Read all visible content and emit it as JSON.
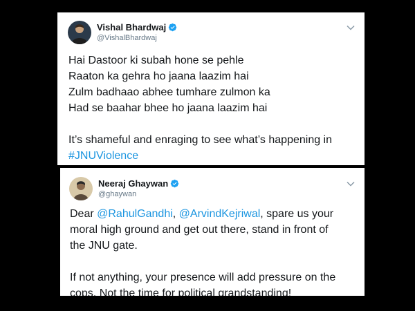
{
  "tweets": [
    {
      "display_name": "Vishal Bhardwaj",
      "handle": "@VishalBhardwaj",
      "verified": true,
      "avatar_icon": "user-avatar-icon",
      "poem_lines": [
        "Hai Dastoor ki subah hone se pehle",
        "Raaton ka gehra ho jaana laazim hai",
        "Zulm badhaao abhee tumhare zulmon ka",
        "Had se baahar bhee ho jaana laazim hai"
      ],
      "closing_line": "It’s shameful and enraging to see what’s happening in",
      "hashtag": "#JNUViolence"
    },
    {
      "display_name": "Neeraj Ghaywan",
      "handle": "@ghaywan",
      "verified": true,
      "avatar_icon": "user-avatar-icon",
      "para1_prefix": "Dear ",
      "mention1": "@RahulGandhi",
      "para1_sep": ", ",
      "mention2": "@ArvindKejriwal",
      "para1_rest": ", spare us your",
      "para1_line2": "moral high ground and get out there, stand in front of",
      "para1_line3": "the JNU gate.",
      "para2_line1": "If not anything, your presence will add pressure on the",
      "para2_line2": "cops. Not the time for political grandstanding!"
    }
  ],
  "colors": {
    "background": "#000000",
    "card": "#ffffff",
    "link": "#1b95e0",
    "verified": "#1da1f2",
    "text": "#14171a",
    "muted": "#657786"
  }
}
